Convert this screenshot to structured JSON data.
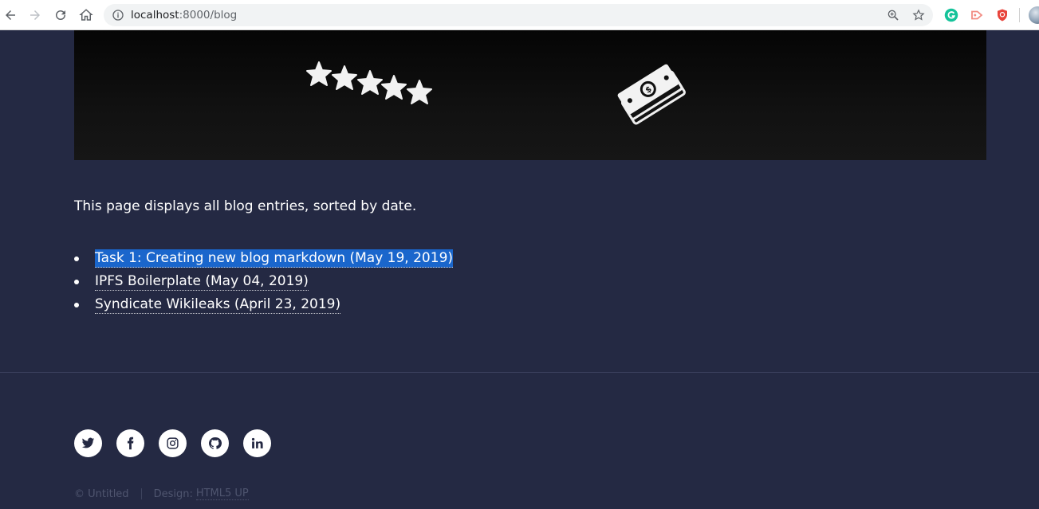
{
  "browser": {
    "url_host": "localhost",
    "url_rest": ":8000/blog",
    "icons": [
      "back-arrow-icon",
      "forward-arrow-icon",
      "reload-icon",
      "home-icon",
      "info-icon",
      "zoom-icon",
      "star-icon",
      "grammarly-icon",
      "extension-icon",
      "shield-icon"
    ]
  },
  "page": {
    "intro": "This page displays all blog entries, sorted by date.",
    "posts": [
      {
        "label": "Task 1: Creating new blog markdown (May 19, 2019)",
        "selected": true
      },
      {
        "label": "IPFS Boilerplate (May 04, 2019)",
        "selected": false
      },
      {
        "label": "Syndicate Wikileaks (April 23, 2019)",
        "selected": false
      }
    ]
  },
  "footer": {
    "social_icons": [
      "twitter-icon",
      "facebook-icon",
      "instagram-icon",
      "github-icon",
      "linkedin-icon"
    ],
    "copyright": "© Untitled",
    "design_label": "Design:",
    "design_link": "HTML5 UP"
  },
  "colors": {
    "background": "#242943",
    "selection": "#1a66cc",
    "text": "#ffffff",
    "muted": "#4f556f"
  }
}
